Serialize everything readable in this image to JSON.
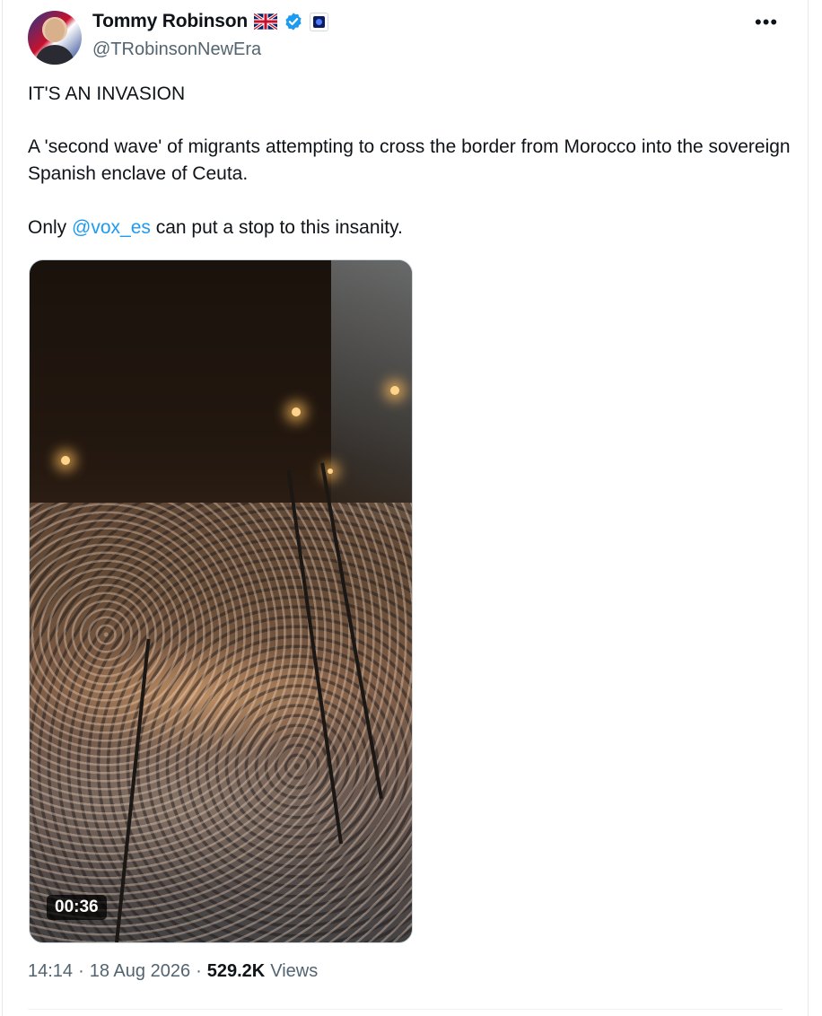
{
  "author": {
    "name": "Tommy Robinson",
    "handle": "@TRobinsonNewEra",
    "flag_icon": "union-jack-flag-icon",
    "verified_icon": "verified-badge-icon",
    "affiliate_icon": "affiliate-badge-icon",
    "verified_color": "#1d9bf0"
  },
  "tweet": {
    "line1": "IT'S AN INVASION",
    "line2": "A 'second wave' of migrants attempting to cross the border from Morocco into the sovereign Spanish enclave of Ceuta.",
    "line3_prefix": "Only ",
    "mention": "@vox_es",
    "line3_suffix": " can put a stop to this insanity."
  },
  "media": {
    "duration": "00:36"
  },
  "meta": {
    "time": "14:14",
    "sep1": "·",
    "date": "18 Aug 2026",
    "sep2": "·",
    "views_count": "529.2K",
    "views_label": "Views"
  },
  "colors": {
    "link": "#1d9bf0",
    "secondary_text": "#536471",
    "primary_text": "#0f1419"
  }
}
